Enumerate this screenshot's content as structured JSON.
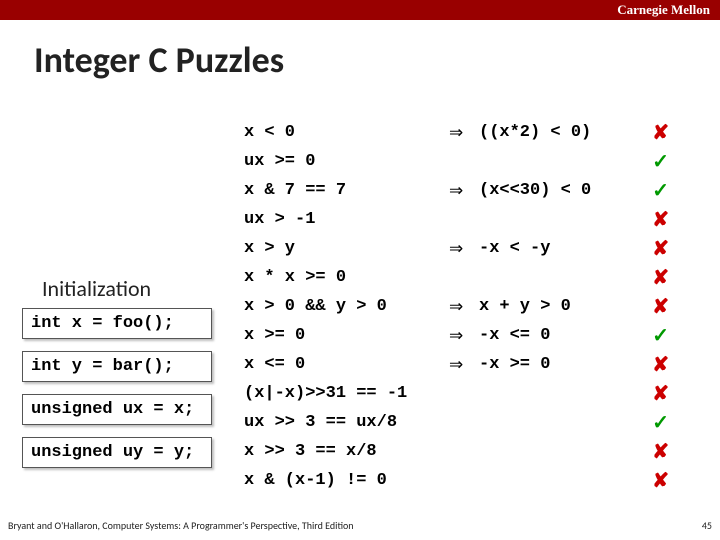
{
  "university": "Carnegie Mellon",
  "title": "Integer C Puzzles",
  "init_label": "Initialization",
  "init": [
    "int x = foo();",
    "int y = bar();",
    "unsigned ux = x;",
    "unsigned uy = y;"
  ],
  "arrow": "⇒",
  "check": "✓",
  "cross": "✘",
  "rows": [
    {
      "lhs": "x < 0",
      "arrow": true,
      "rhs": "((x*2) < 0)",
      "mark": "no"
    },
    {
      "lhs": "ux >= 0",
      "arrow": false,
      "rhs": "",
      "mark": "ok"
    },
    {
      "lhs": "x & 7 == 7",
      "arrow": true,
      "rhs": "(x<<30) < 0",
      "mark": "ok"
    },
    {
      "lhs": "ux > -1",
      "arrow": false,
      "rhs": "",
      "mark": "no"
    },
    {
      "lhs": "x > y",
      "arrow": true,
      "rhs": "-x < -y",
      "mark": "no"
    },
    {
      "lhs": "x * x >= 0",
      "arrow": false,
      "rhs": "",
      "mark": "no"
    },
    {
      "lhs": "x > 0 && y > 0",
      "arrow": true,
      "rhs": "x + y > 0",
      "mark": "no"
    },
    {
      "lhs": "x >= 0",
      "arrow": true,
      "rhs": "-x <= 0",
      "mark": "ok"
    },
    {
      "lhs": "x <= 0",
      "arrow": true,
      "rhs": "-x >= 0",
      "mark": "no"
    },
    {
      "lhs": "(x|-x)>>31 == -1",
      "arrow": false,
      "rhs": "",
      "mark": "no"
    },
    {
      "lhs": "ux >> 3 == ux/8",
      "arrow": false,
      "rhs": "",
      "mark": "ok"
    },
    {
      "lhs": "x >> 3 == x/8",
      "arrow": false,
      "rhs": "",
      "mark": "no"
    },
    {
      "lhs": "x & (x-1) != 0",
      "arrow": false,
      "rhs": "",
      "mark": "no"
    }
  ],
  "footer_left": "Bryant and O'Hallaron, Computer Systems: A Programmer's Perspective, Third Edition",
  "footer_right": "45"
}
